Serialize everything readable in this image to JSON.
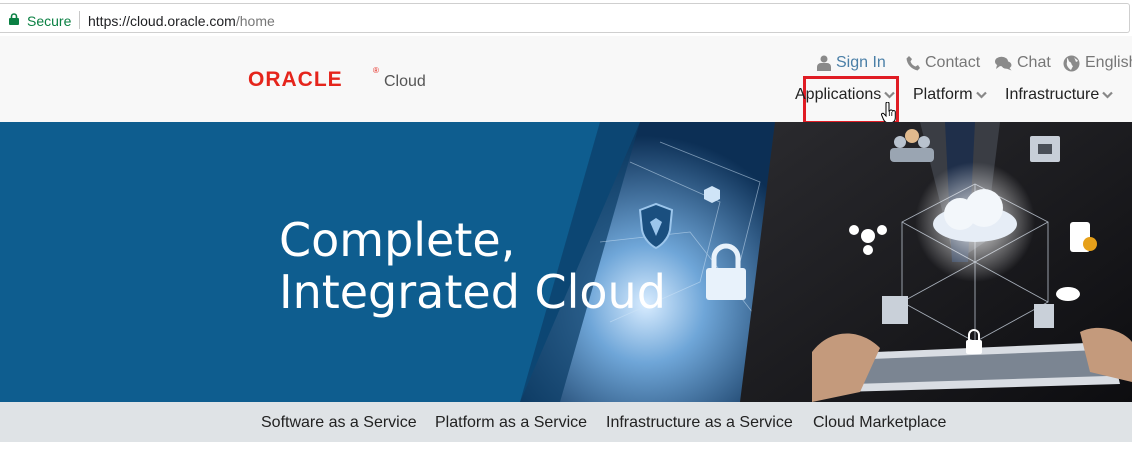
{
  "address_bar": {
    "secure_label": "Secure",
    "url_base": "https://cloud.oracle.com",
    "url_path": "/home"
  },
  "header": {
    "logo_text": "ORACLE",
    "logo_reg": "®",
    "logo_sub": "Cloud",
    "utility_links": {
      "sign_in": "Sign In",
      "contact": "Contact",
      "chat": "Chat",
      "language": "English"
    },
    "main_nav": {
      "applications": "Applications",
      "platform": "Platform",
      "infrastructure": "Infrastructure"
    }
  },
  "hero": {
    "title_line1": "Complete,",
    "title_line2": "Integrated Cloud"
  },
  "subnav": {
    "saas": "Software as a Service",
    "paas": "Platform as a Service",
    "iaas": "Infrastructure as a Service",
    "marketplace": "Cloud Marketplace"
  },
  "colors": {
    "brand_red": "#e5251c",
    "hero_blue": "#0e5d8f",
    "secure_green": "#0b8043",
    "highlight_red": "#e01c24",
    "link_blue": "#4a7fa7"
  },
  "icons": {
    "lock": "lock-icon",
    "user": "user-icon",
    "phone": "phone-icon",
    "chat": "chat-bubbles-icon",
    "globe": "globe-icon",
    "chevron": "chevron-down-icon",
    "cursor": "hand-cursor-icon"
  }
}
